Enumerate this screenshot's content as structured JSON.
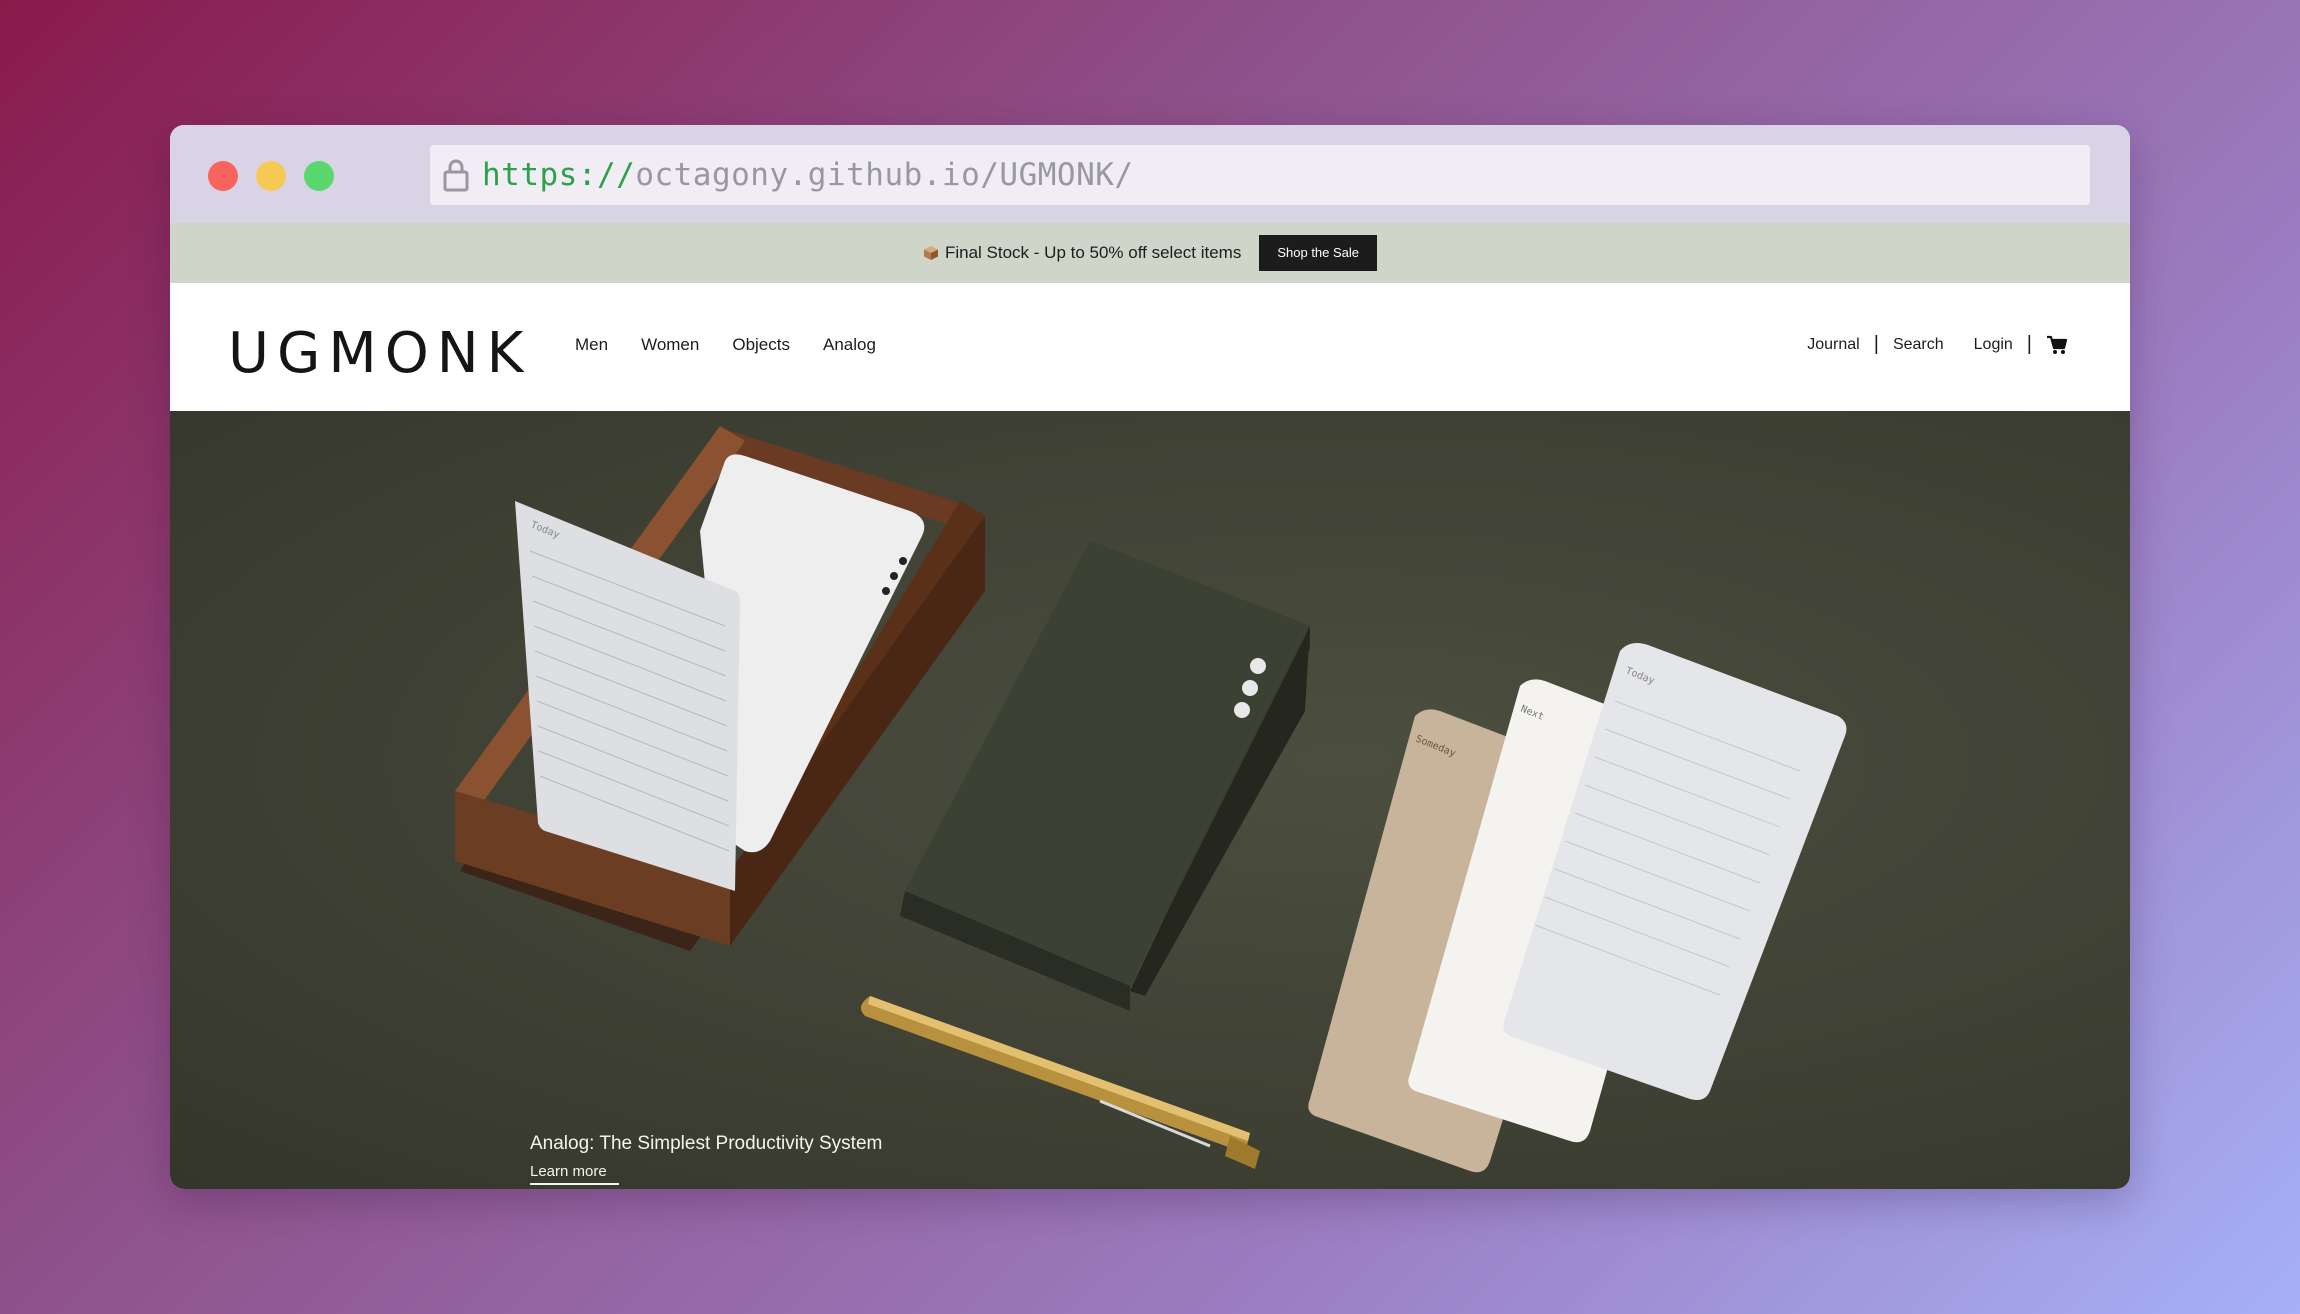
{
  "browser": {
    "url_scheme": "https://",
    "url_rest": "octagony.github.io/UGMONK/"
  },
  "promo": {
    "text": "Final Stock - Up to 50% off select items",
    "button_label": "Shop the Sale"
  },
  "header": {
    "logo": "UGMONK",
    "nav_left": [
      "Men",
      "Women",
      "Objects",
      "Analog"
    ],
    "journal_label": "Journal",
    "search_label": "Search",
    "login_label": "Login",
    "separator": "|"
  },
  "hero": {
    "card_labels": [
      "Today",
      "Someday",
      "Next",
      "Today"
    ],
    "caption": "Analog: The Simplest Productivity System",
    "link_label": "Learn more"
  },
  "colors": {
    "promo_bg": "#d0d5ca",
    "hero_bg": "#3e4033",
    "url_scheme": "#2fa04a"
  },
  "icons": [
    "lock-icon",
    "box-icon",
    "cart-icon"
  ]
}
